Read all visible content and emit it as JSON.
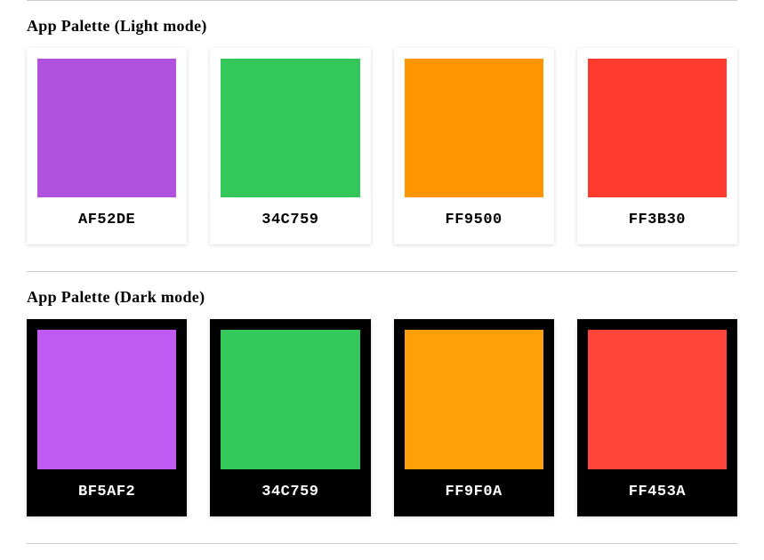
{
  "sections": [
    {
      "title": "App Palette (Light mode)",
      "mode": "light",
      "swatches": [
        {
          "hex": "AF52DE",
          "color": "#AF52DE"
        },
        {
          "hex": "34C759",
          "color": "#34C759"
        },
        {
          "hex": "FF9500",
          "color": "#FF9500"
        },
        {
          "hex": "FF3B30",
          "color": "#FF3B30"
        }
      ]
    },
    {
      "title": "App Palette (Dark mode)",
      "mode": "dark",
      "swatches": [
        {
          "hex": "BF5AF2",
          "color": "#BF5AF2"
        },
        {
          "hex": "34C759",
          "color": "#34C759"
        },
        {
          "hex": "FF9F0A",
          "color": "#FF9F0A"
        },
        {
          "hex": "FF453A",
          "color": "#FF453A"
        }
      ]
    }
  ]
}
